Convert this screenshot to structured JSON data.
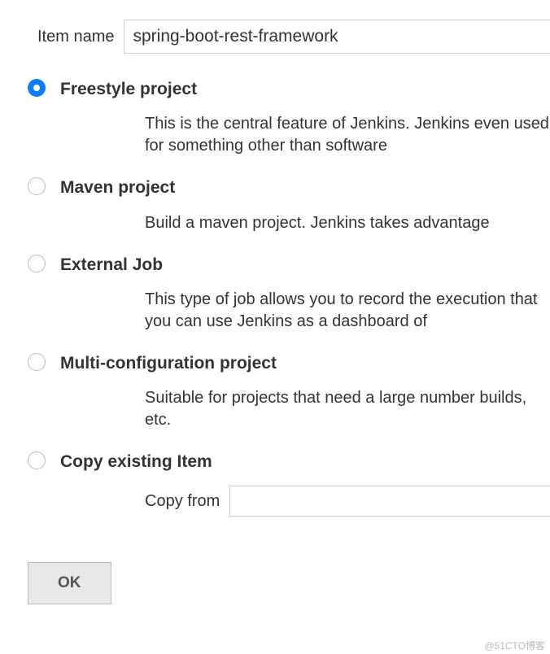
{
  "item_name": {
    "label": "Item name",
    "value": "spring-boot-rest-framework"
  },
  "options": [
    {
      "id": "freestyle",
      "title": "Freestyle project",
      "description": "This is the central feature of Jenkins. Jenkins even used for something other than software",
      "selected": true
    },
    {
      "id": "maven",
      "title": "Maven project",
      "description": "Build a maven project. Jenkins takes advantage",
      "selected": false
    },
    {
      "id": "external",
      "title": "External Job",
      "description": "This type of job allows you to record the execution that you can use Jenkins as a dashboard of",
      "selected": false
    },
    {
      "id": "multiconfig",
      "title": "Multi-configuration project",
      "description": "Suitable for projects that need a large number builds, etc.",
      "selected": false
    },
    {
      "id": "copy",
      "title": "Copy existing Item",
      "description": "",
      "selected": false
    }
  ],
  "copy_from": {
    "label": "Copy from",
    "value": ""
  },
  "actions": {
    "ok_label": "OK"
  },
  "watermark": "@51CTO博客"
}
